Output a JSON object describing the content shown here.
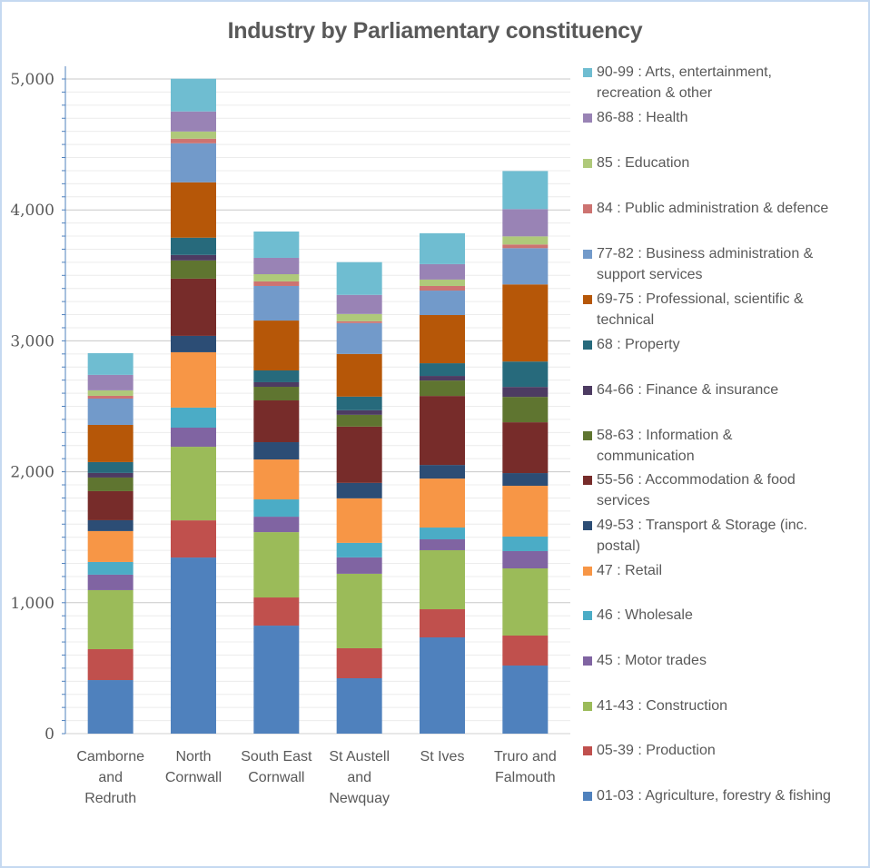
{
  "chart_data": {
    "type": "bar",
    "stacked": true,
    "title": "Industry by Parliamentary constituency",
    "xlabel": "",
    "ylabel": "",
    "ylim": [
      0,
      5000
    ],
    "yticks": [
      0,
      1000,
      2000,
      3000,
      4000,
      5000
    ],
    "ytick_labels": [
      "0",
      "1,000",
      "2,000",
      "3,000",
      "4,000",
      "5,000"
    ],
    "grid": true,
    "legend_position": "right",
    "categories": [
      "Camborne and Redruth",
      "North Cornwall",
      "South East Cornwall",
      "St Austell and Newquay",
      "St Ives",
      "Truro and Falmouth"
    ],
    "category_lines": [
      [
        "Camborne",
        "and",
        "Redruth"
      ],
      [
        "North",
        "Cornwall"
      ],
      [
        "South East",
        "Cornwall"
      ],
      [
        "St Austell",
        "and",
        "Newquay"
      ],
      [
        "St Ives"
      ],
      [
        "Truro and",
        "Falmouth"
      ]
    ],
    "series": [
      {
        "name": "01-03 : Agriculture, forestry & fishing",
        "color": "#4f81bd",
        "values": [
          409,
          1345,
          825,
          423,
          735,
          520
        ]
      },
      {
        "name": "05-39 : Production",
        "color": "#c0504d",
        "values": [
          236,
          284,
          215,
          229,
          215,
          229
        ]
      },
      {
        "name": "41-43 : Construction",
        "color": "#9bbb59",
        "values": [
          451,
          562,
          499,
          569,
          451,
          513
        ]
      },
      {
        "name": "45 : Motor trades",
        "color": "#8064a2",
        "values": [
          118,
          146,
          118,
          125,
          83,
          132
        ]
      },
      {
        "name": "46 : Wholesale",
        "color": "#4bacc6",
        "values": [
          97,
          153,
          132,
          111,
          90,
          111
        ]
      },
      {
        "name": "47 : Retail",
        "color": "#f79646",
        "values": [
          236,
          423,
          305,
          340,
          374,
          388
        ]
      },
      {
        "name": "49-53 : Transport & Storage (inc. postal)",
        "color": "#2c4d75",
        "values": [
          83,
          125,
          132,
          118,
          104,
          97
        ]
      },
      {
        "name": "55-56 : Accommodation & food services",
        "color": "#772c2a",
        "values": [
          222,
          437,
          319,
          430,
          527,
          388
        ]
      },
      {
        "name": "58-63 : Information & communication",
        "color": "#5f7530",
        "values": [
          104,
          139,
          104,
          90,
          118,
          194
        ]
      },
      {
        "name": "64-66 : Finance & insurance",
        "color": "#4d3b62",
        "values": [
          35,
          42,
          35,
          35,
          35,
          76
        ]
      },
      {
        "name": "68 : Property",
        "color": "#276a7c",
        "values": [
          83,
          132,
          90,
          104,
          97,
          194
        ]
      },
      {
        "name": "69-75 : Professional, scientific & technical",
        "color": "#b65708",
        "values": [
          284,
          423,
          381,
          326,
          368,
          589
        ]
      },
      {
        "name": "77-82 : Business administration & support services",
        "color": "#729aca",
        "values": [
          201,
          298,
          264,
          236,
          187,
          277
        ]
      },
      {
        "name": "84 : Public administration & defence",
        "color": "#cd7371",
        "values": [
          21,
          35,
          35,
          14,
          35,
          28
        ]
      },
      {
        "name": "85 : Education",
        "color": "#afc97a",
        "values": [
          42,
          55,
          55,
          55,
          49,
          62
        ]
      },
      {
        "name": "86-88 : Health",
        "color": "#9983b5",
        "values": [
          118,
          153,
          125,
          146,
          118,
          208
        ]
      },
      {
        "name": "90-99 : Arts, entertainment, recreation & other",
        "color": "#6fbdd1",
        "values": [
          166,
          250,
          201,
          250,
          236,
          291
        ]
      }
    ],
    "legend_lines": [
      [
        "90-99 : Arts, entertainment,",
        "recreation & other"
      ],
      [
        "86-88 : Health"
      ],
      [
        "85 : Education"
      ],
      [
        "84 : Public administration & defence"
      ],
      [
        "77-82 : Business administration &",
        "support services"
      ],
      [
        "69-75 : Professional, scientific &",
        "technical"
      ],
      [
        "68 : Property"
      ],
      [
        "64-66 : Finance & insurance"
      ],
      [
        "58-63 : Information &",
        "communication"
      ],
      [
        "55-56 : Accommodation & food",
        "services"
      ],
      [
        "49-53 : Transport & Storage (inc.",
        "postal)"
      ],
      [
        "47 : Retail"
      ],
      [
        "46 : Wholesale"
      ],
      [
        "45 : Motor trades"
      ],
      [
        "41-43 : Construction"
      ],
      [
        "05-39 : Production"
      ],
      [
        "01-03 : Agriculture, forestry & fishing"
      ]
    ]
  }
}
